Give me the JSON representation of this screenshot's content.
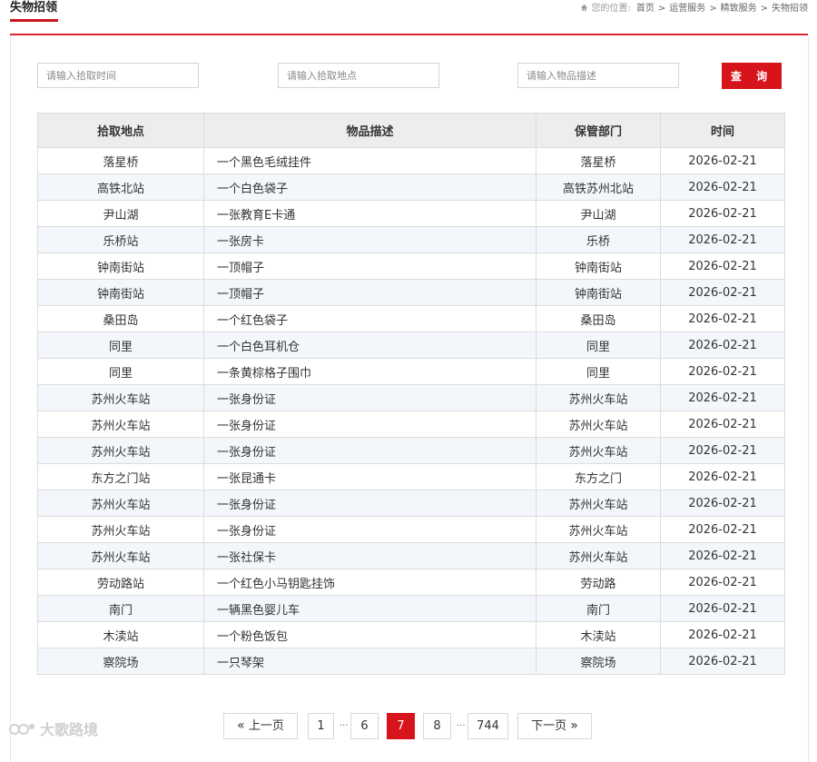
{
  "header": {
    "title": "失物招领",
    "breadcrumb_prefix": "您的位置:",
    "breadcrumb": [
      "首页",
      "运营服务",
      "精致服务",
      "失物招领"
    ],
    "accent_color": "#d7141c"
  },
  "search": {
    "time_placeholder": "请输入拾取时间",
    "place_placeholder": "请输入拾取地点",
    "desc_placeholder": "请输入物品描述",
    "button_label": "查 询"
  },
  "table": {
    "columns": [
      "拾取地点",
      "物品描述",
      "保管部门",
      "时间"
    ],
    "rows": [
      [
        "落星桥",
        "一个黑色毛绒挂件",
        "落星桥",
        "2026-02-21"
      ],
      [
        "高铁北站",
        "一个白色袋子",
        "高铁苏州北站",
        "2026-02-21"
      ],
      [
        "尹山湖",
        "一张教育E卡通",
        "尹山湖",
        "2026-02-21"
      ],
      [
        "乐桥站",
        "一张房卡",
        "乐桥",
        "2026-02-21"
      ],
      [
        "钟南街站",
        "一顶帽子",
        "钟南街站",
        "2026-02-21"
      ],
      [
        "钟南街站",
        "一顶帽子",
        "钟南街站",
        "2026-02-21"
      ],
      [
        "桑田岛",
        "一个红色袋子",
        "桑田岛",
        "2026-02-21"
      ],
      [
        "同里",
        "一个白色耳机仓",
        "同里",
        "2026-02-21"
      ],
      [
        "同里",
        "一条黄棕格子围巾",
        "同里",
        "2026-02-21"
      ],
      [
        "苏州火车站",
        "一张身份证",
        "苏州火车站",
        "2026-02-21"
      ],
      [
        "苏州火车站",
        "一张身份证",
        "苏州火车站",
        "2026-02-21"
      ],
      [
        "苏州火车站",
        "一张身份证",
        "苏州火车站",
        "2026-02-21"
      ],
      [
        "东方之门站",
        "一张昆通卡",
        "东方之门",
        "2026-02-21"
      ],
      [
        "苏州火车站",
        "一张身份证",
        "苏州火车站",
        "2026-02-21"
      ],
      [
        "苏州火车站",
        "一张身份证",
        "苏州火车站",
        "2026-02-21"
      ],
      [
        "苏州火车站",
        "一张社保卡",
        "苏州火车站",
        "2026-02-21"
      ],
      [
        "劳动路站",
        "一个红色小马钥匙挂饰",
        "劳动路",
        "2026-02-21"
      ],
      [
        "南门",
        "一辆黑色婴儿车",
        "南门",
        "2026-02-21"
      ],
      [
        "木渎站",
        "一个粉色饭包",
        "木渎站",
        "2026-02-21"
      ],
      [
        "察院场",
        "一只琴架",
        "察院场",
        "2026-02-21"
      ]
    ]
  },
  "pagination": {
    "prev_label": "上一页",
    "next_label": "下一页",
    "pages": [
      "1",
      "6",
      "7",
      "8",
      "744"
    ],
    "current": "7",
    "ellipsis": "..."
  },
  "watermark": {
    "text": "大歌路境"
  }
}
